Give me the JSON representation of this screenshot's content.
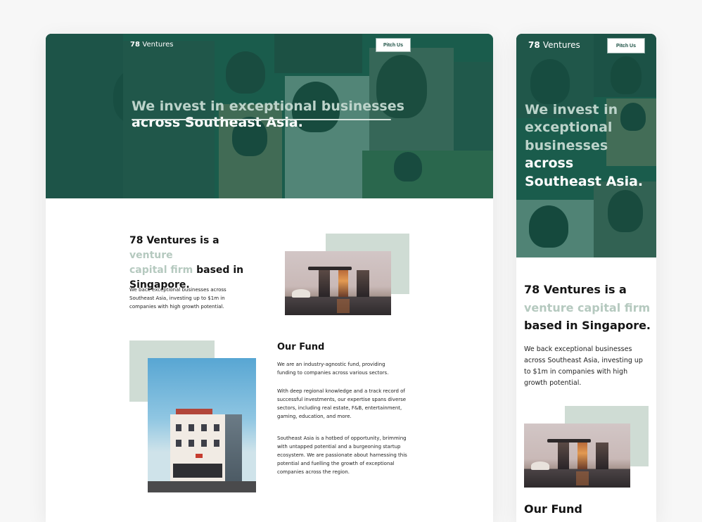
{
  "brand": {
    "name_bold": "78",
    "name_light": "Ventures"
  },
  "nav": {
    "pitch_label": "Pitch Us"
  },
  "hero": {
    "headline_line1": "We invest in exceptional businesses",
    "headline_line2": "across Southeast Asia.",
    "mobile_line1": "We invest in",
    "mobile_line2": "exceptional",
    "mobile_line3": "businesses",
    "mobile_line4": "across",
    "mobile_line5": "Southeast Asia."
  },
  "about": {
    "title_prefix": "78 Ventures is a",
    "title_accent": "venture capital firm",
    "title_suffix": "based in Singapore.",
    "desk_line1_prefix": "78 Ventures is a ",
    "desk_line1_accent": "venture",
    "desk_line2_accent": "capital firm",
    "desk_line2_suffix": " based in",
    "desk_line3": "Singapore.",
    "body": "We back exceptional businesses across Southeast Asia, investing up to $1m in companies with high growth potential."
  },
  "fund": {
    "title": "Our Fund",
    "p1": "We are an industry-agnostic fund, providing funding to companies across various sectors.",
    "p2": "With deep regional knowledge and a track record of successful investments, our expertise spans diverse sectors, including real estate, F&B, entertainment, gaming, education, and more.",
    "p3": "Southeast Asia is a hotbed of opportunity, brimming with untapped potential and a burgeoning startup ecosystem. We are passionate about harnessing this potential and fuelling the growth of exceptional companies across the region."
  },
  "colors": {
    "overlay": "#165e4e",
    "accent": "#b5c9bf",
    "sage_block": "#cfdcd4",
    "button_text": "#184d40"
  }
}
